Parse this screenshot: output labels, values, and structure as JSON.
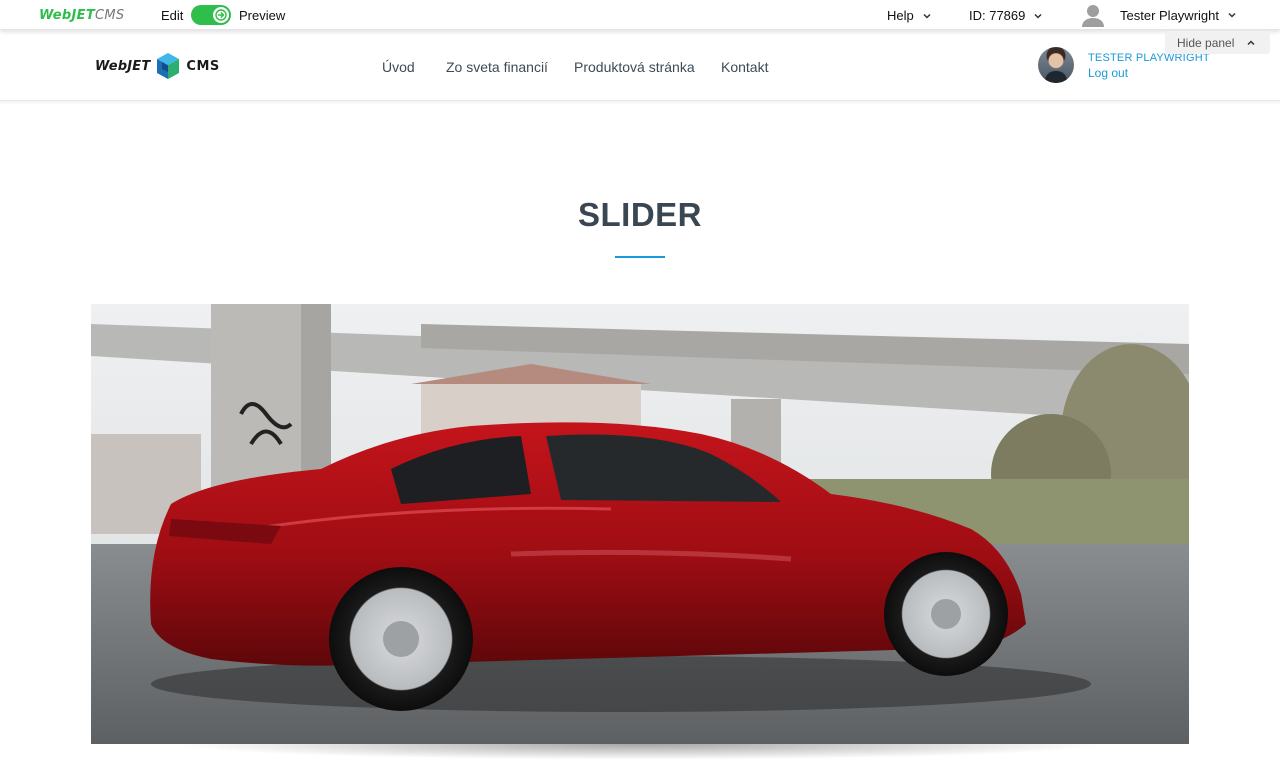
{
  "admin_bar": {
    "logo": {
      "web": "Web",
      "jet": "JET",
      "cms": "CMS"
    },
    "edit_label": "Edit",
    "preview_label": "Preview",
    "help_label": "Help",
    "id_label": "ID: 77869",
    "user_label": "Tester Playwright",
    "hide_panel_label": "Hide panel",
    "accent_color": "#2fbd4b"
  },
  "header": {
    "logo": {
      "part1": "WebJET",
      "part2": "CMS"
    },
    "nav": [
      "Úvod",
      "Zo sveta financií",
      "Produktová stránka",
      "Kontakt"
    ],
    "profile_name": "TESTER PLAYWRIGHT",
    "logout_label": "Log out",
    "link_color": "#1a9ad8"
  },
  "main": {
    "title": "SLIDER",
    "slider_image_desc": "red-car-photo"
  }
}
